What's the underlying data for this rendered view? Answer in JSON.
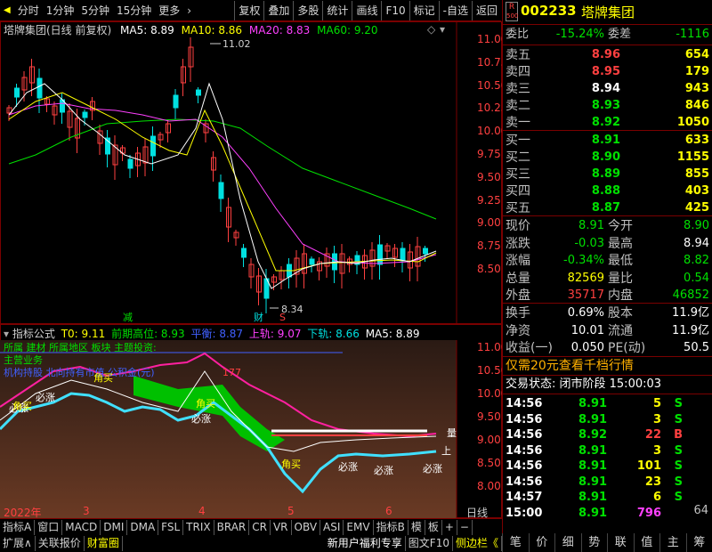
{
  "toolbar": {
    "nav_arrow": "◀",
    "items": [
      "分时",
      "1分钟",
      "5分钟",
      "15分钟",
      "更多"
    ],
    "more_arrow": "›",
    "right": [
      "复权",
      "叠加",
      "多股",
      "统计",
      "画线",
      "F10",
      "标记",
      "-自选",
      "返回"
    ]
  },
  "chart": {
    "title": "塔牌集团(日线 前复权)",
    "ma5": "MA5: 8.89",
    "ma10": "MA10: 8.86",
    "ma20": "MA20: 8.83",
    "ma60": "MA60: 9.20",
    "yticks": [
      "11.00",
      "10.75",
      "10.50",
      "10.25",
      "10.00",
      "9.75",
      "9.50",
      "9.25",
      "9.00",
      "8.75",
      "8.50"
    ],
    "high_label": "11.02",
    "low_label": "8.34",
    "mark_jian": "减",
    "mark_cai": "财",
    "mark_s": "S"
  },
  "indicator": {
    "name": "指标公式",
    "t0": "T0: 9.11",
    "prev_high": "前期高位: 8.93",
    "ping_heng": "平衡: 8.87",
    "shang_gui": "上轨: 9.07",
    "xia_gui": "下轨: 8.66",
    "ma5": "MA5: 8.89",
    "yticks": [
      "11.00",
      "10.50",
      "10.00",
      "9.50",
      "9.00",
      "8.50",
      "8.00"
    ],
    "overlay1": "所属 建材 所属地区 板块 主题投资:",
    "overlay2": "主营业务",
    "overlay3": "机构持股 北向持有市值 公积金(元)",
    "overlay4": "177",
    "zhang_label": "必涨",
    "mai_label": "角买",
    "liang": "量",
    "shang": "上",
    "date_labels": [
      "2022年",
      "3",
      "4",
      "5",
      "6"
    ],
    "date_end": "日线"
  },
  "tabs": [
    "指标A",
    "窗口",
    "MACD",
    "DMI",
    "DMA",
    "FSL",
    "TRIX",
    "BRAR",
    "CR",
    "VR",
    "OBV",
    "ASI",
    "EMV",
    "指标B",
    "模",
    "板",
    "+",
    "−"
  ],
  "bottom": {
    "left": [
      "扩展∧",
      "关联报价",
      "财富圈"
    ],
    "news": "新用户福利专享",
    "f10": "图文F10",
    "side": "侧边栏《"
  },
  "quote": {
    "badge_r": "R",
    "badge_num": "500",
    "code": "002233",
    "name": "塔牌集团",
    "weibi_label": "委比",
    "weibi": "-15.24%",
    "weicha_label": "委差",
    "weicha": "-1116",
    "asks": [
      {
        "label": "卖五",
        "price": "8.96",
        "vol": "654"
      },
      {
        "label": "卖四",
        "price": "8.95",
        "vol": "179"
      },
      {
        "label": "卖三",
        "price": "8.94",
        "vol": "943"
      },
      {
        "label": "卖二",
        "price": "8.93",
        "vol": "846"
      },
      {
        "label": "卖一",
        "price": "8.92",
        "vol": "1050"
      }
    ],
    "bids": [
      {
        "label": "买一",
        "price": "8.91",
        "vol": "633"
      },
      {
        "label": "买二",
        "price": "8.90",
        "vol": "1155"
      },
      {
        "label": "买三",
        "price": "8.89",
        "vol": "855"
      },
      {
        "label": "买四",
        "price": "8.88",
        "vol": "403"
      },
      {
        "label": "买五",
        "price": "8.87",
        "vol": "425"
      }
    ],
    "stats": [
      [
        "现价",
        "8.91",
        "今开",
        "8.90"
      ],
      [
        "涨跌",
        "-0.03",
        "最高",
        "8.94"
      ],
      [
        "涨幅",
        "-0.34%",
        "最低",
        "8.82"
      ],
      [
        "总量",
        "82569",
        "量比",
        "0.54"
      ],
      [
        "外盘",
        "35717",
        "内盘",
        "46852"
      ]
    ],
    "stats2": [
      [
        "换手",
        "0.69%",
        "股本",
        "11.9亿"
      ],
      [
        "净资",
        "10.01",
        "流通",
        "11.9亿"
      ],
      [
        "收益(一)",
        "0.050",
        "PE(动)",
        "50.5"
      ]
    ],
    "promo": "仅需20元查看千档行情",
    "status": "交易状态: 闭市阶段 15:00:03",
    "ticks": [
      [
        "14:56",
        "8.91",
        "5",
        "S"
      ],
      [
        "14:56",
        "8.91",
        "3",
        "S"
      ],
      [
        "14:56",
        "8.92",
        "22",
        "B"
      ],
      [
        "14:56",
        "8.91",
        "3",
        "S"
      ],
      [
        "14:56",
        "8.91",
        "101",
        "S"
      ],
      [
        "14:56",
        "8.91",
        "23",
        "S"
      ],
      [
        "14:57",
        "8.91",
        "6",
        "S"
      ],
      [
        "15:00",
        "8.91",
        "796",
        ""
      ]
    ],
    "tick_end": "64",
    "rtabs": [
      "笔",
      "价",
      "细",
      "势",
      "联",
      "值",
      "主",
      "筹"
    ]
  },
  "colors": {
    "up": "#ff4040",
    "down": "#00e0e0",
    "ma5": "#ffffff",
    "ma10": "#ffff00",
    "ma20": "#ff40ff",
    "ma60": "#00e000"
  }
}
